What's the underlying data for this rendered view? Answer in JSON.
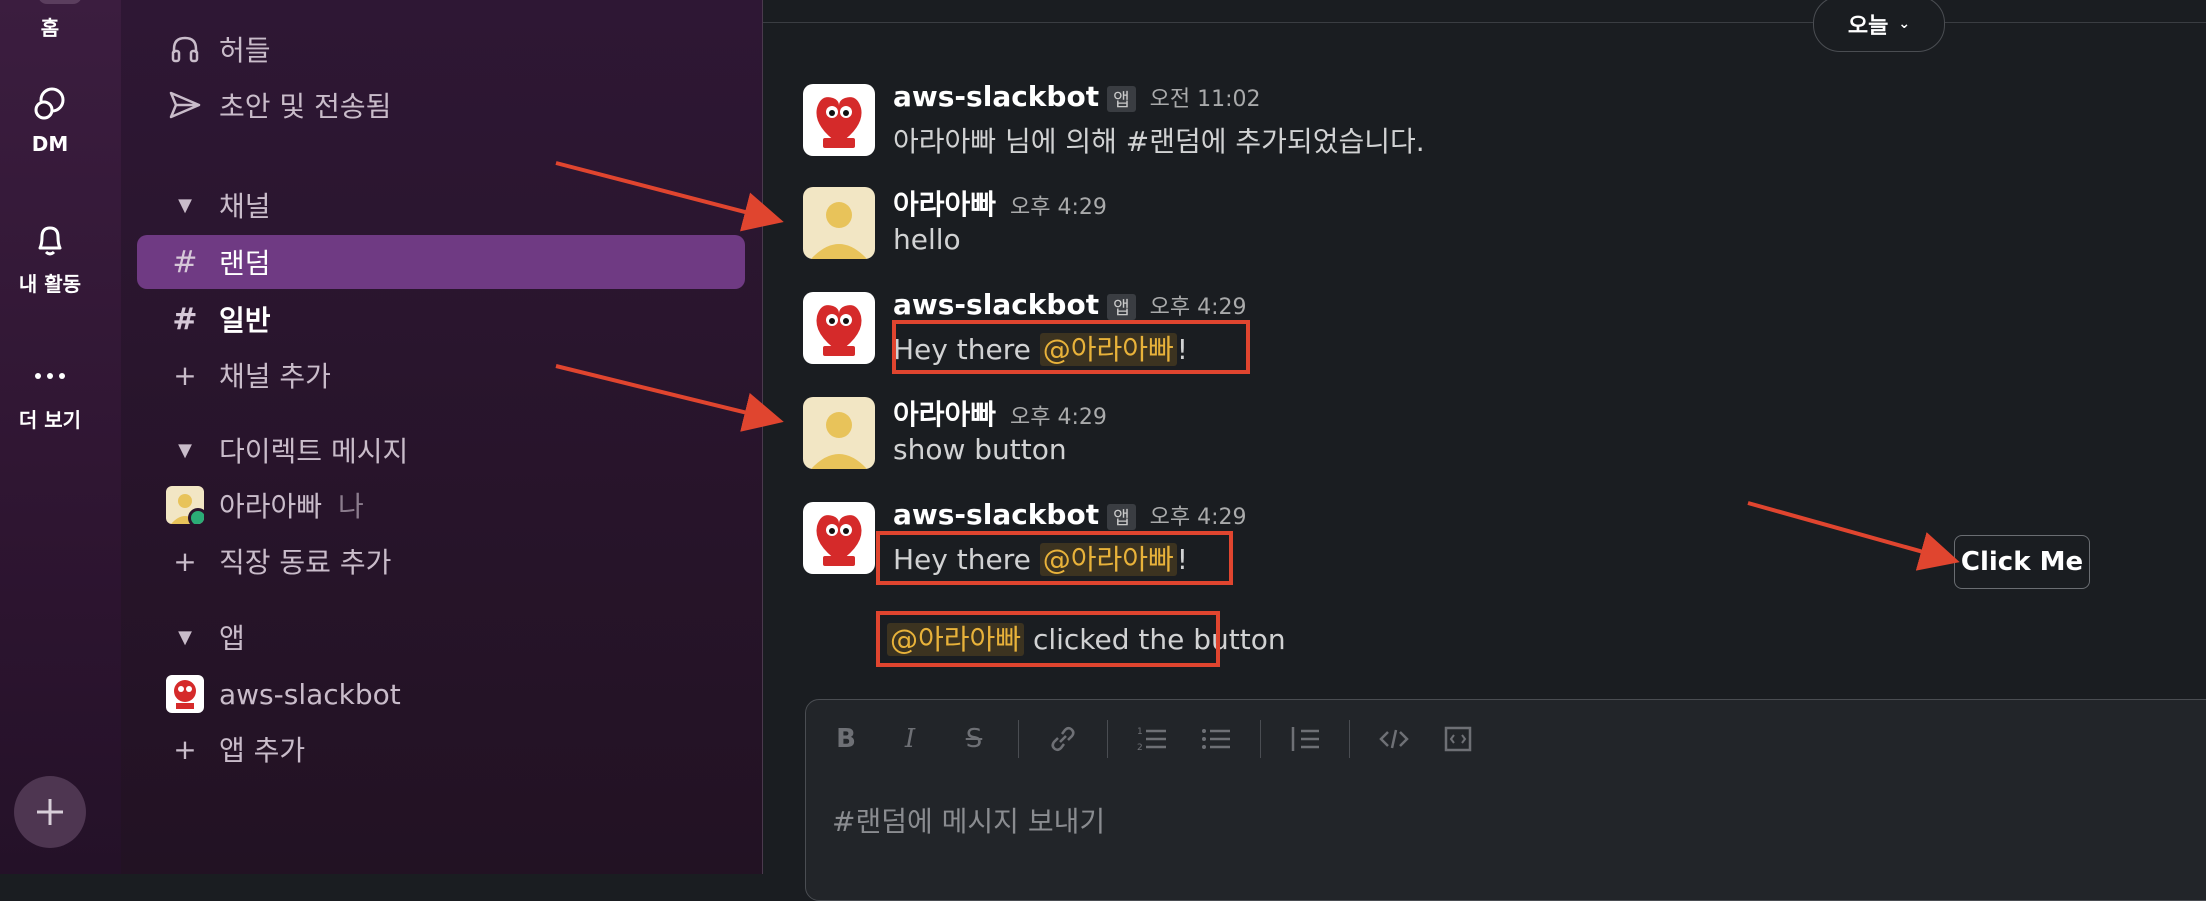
{
  "rail": {
    "home_label": "홈",
    "dm_label": "DM",
    "activity_label": "내 활동",
    "more_label": "더 보기"
  },
  "sidebar": {
    "huddles": "허들",
    "drafts": "초안 및 전송됨",
    "channels_header": "채널",
    "channels": [
      {
        "label": "랜덤",
        "active": true
      },
      {
        "label": "일반",
        "active": false
      }
    ],
    "add_channel": "채널 추가",
    "dm_header": "다이렉트 메시지",
    "dm_user": "아라아빠",
    "dm_user_suffix": "나",
    "add_coworker": "직장 동료 추가",
    "apps_header": "앱",
    "app_name": "aws-slackbot",
    "add_app": "앱 추가"
  },
  "main": {
    "today": "오늘",
    "messages": [
      {
        "name": "aws-slackbot",
        "badge": "앱",
        "time": "오전 11:02",
        "text": "아라아빠 님에 의해 #랜덤에 추가되었습니다."
      },
      {
        "name": "아라아빠",
        "time": "오후 4:29",
        "text": "hello"
      },
      {
        "name": "aws-slackbot",
        "badge": "앱",
        "time": "오후 4:29",
        "text_pre": "Hey there ",
        "mention": "@아라아빠",
        "text_post": "!"
      },
      {
        "name": "아라아빠",
        "time": "오후 4:29",
        "text": "show button"
      },
      {
        "name": "aws-slackbot",
        "badge": "앱",
        "time": "오후 4:29",
        "text_pre": "Hey there ",
        "mention": "@아라아빠",
        "text_post": "!",
        "followup_mention": "@아라아빠",
        "followup_text": " clicked the button"
      }
    ],
    "button_label": "Click Me",
    "composer_placeholder": "#랜덤에 메시지 보내기"
  },
  "colors": {
    "accent_active": "#6f3a83",
    "annotation_red": "#e0452f",
    "mention": "#e8b23a"
  }
}
